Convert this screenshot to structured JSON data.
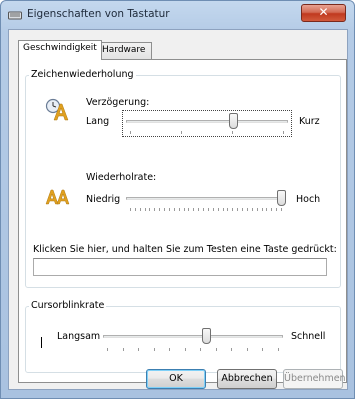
{
  "window": {
    "title": "Eigenschaften von Tastatur",
    "close_glyph": "✕"
  },
  "tabs": [
    {
      "label": "Geschwindigkeit",
      "selected": true
    },
    {
      "label": "Hardware",
      "selected": false
    }
  ],
  "repeat_group": {
    "title": "Zeichenwiederholung",
    "delay": {
      "label": "Verzögerung:",
      "min_label": "Lang",
      "max_label": "Kurz",
      "value_fraction": 0.67,
      "tick_count": 4
    },
    "rate": {
      "label": "Wiederholrate:",
      "min_label": "Niedrig",
      "max_label": "Hoch",
      "value_fraction": 1.0,
      "tick_count": 32
    },
    "test_prompt": "Klicken Sie hier, und halten Sie zum Testen eine Taste gedrückt:",
    "test_value": ""
  },
  "cursor_group": {
    "title": "Cursorblinkrate",
    "slow_label": "Langsam",
    "fast_label": "Schnell",
    "value_fraction": 0.58,
    "tick_count": 12
  },
  "buttons": {
    "ok": "OK",
    "cancel": "Abbrechen",
    "apply": "Übernehmen"
  },
  "icons": {
    "delay": "clock-a-icon",
    "rate": "double-a-icon",
    "window": "keyboard-icon"
  },
  "colors": {
    "icon_gold": "#e0a020",
    "title_close": "#c8432a"
  }
}
